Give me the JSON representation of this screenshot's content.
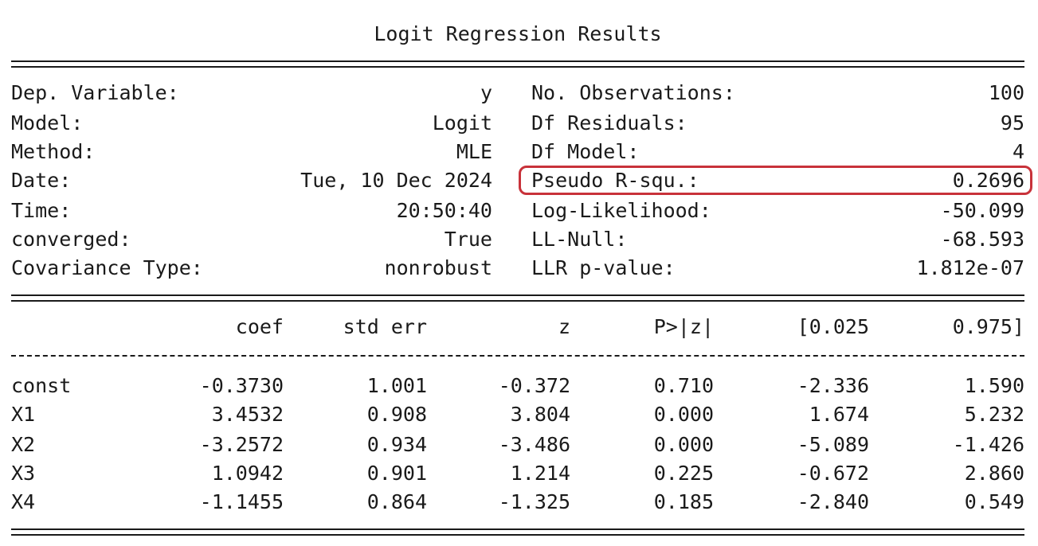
{
  "title": "Logit Regression Results",
  "info_left": [
    {
      "label": "Dep. Variable:",
      "value": "y"
    },
    {
      "label": "Model:",
      "value": "Logit"
    },
    {
      "label": "Method:",
      "value": "MLE"
    },
    {
      "label": "Date:",
      "value": "Tue, 10 Dec 2024"
    },
    {
      "label": "Time:",
      "value": "20:50:40"
    },
    {
      "label": "converged:",
      "value": "True"
    },
    {
      "label": "Covariance Type:",
      "value": "nonrobust"
    }
  ],
  "info_right": [
    {
      "label": "No. Observations:",
      "value": "100"
    },
    {
      "label": "Df Residuals:",
      "value": "95"
    },
    {
      "label": "Df Model:",
      "value": "4"
    },
    {
      "label": "Pseudo R-squ.:",
      "value": "0.2696"
    },
    {
      "label": "Log-Likelihood:",
      "value": "-50.099"
    },
    {
      "label": "LL-Null:",
      "value": "-68.593"
    },
    {
      "label": "LLR p-value:",
      "value": "1.812e-07"
    }
  ],
  "highlight_color": "#c8323a",
  "coef_headers": [
    "coef",
    "std err",
    "z",
    "P>|z|",
    "[0.025",
    "0.975]"
  ],
  "coef_rows": [
    {
      "name": "const",
      "values": [
        "-0.3730",
        "1.001",
        "-0.372",
        "0.710",
        "-2.336",
        "1.590"
      ]
    },
    {
      "name": "X1",
      "values": [
        "3.4532",
        "0.908",
        "3.804",
        "0.000",
        "1.674",
        "5.232"
      ]
    },
    {
      "name": "X2",
      "values": [
        "-3.2572",
        "0.934",
        "-3.486",
        "0.000",
        "-5.089",
        "-1.426"
      ]
    },
    {
      "name": "X3",
      "values": [
        "1.0942",
        "0.901",
        "1.214",
        "0.225",
        "-0.672",
        "2.860"
      ]
    },
    {
      "name": "X4",
      "values": [
        "-1.1455",
        "0.864",
        "-1.325",
        "0.185",
        "-2.840",
        "0.549"
      ]
    }
  ]
}
